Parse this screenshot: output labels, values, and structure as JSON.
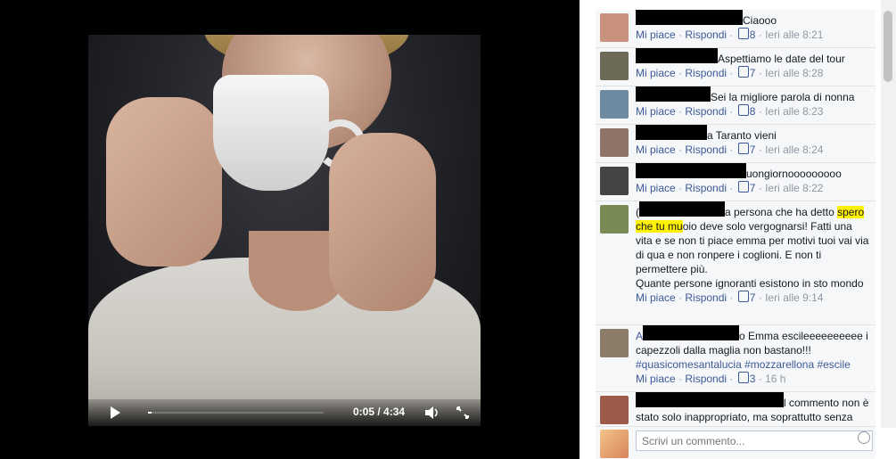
{
  "video": {
    "time": "0:05 / 4:34",
    "progress_fraction": 0.018
  },
  "panel": {
    "close_icon": "×",
    "composer_placeholder": "Scrivi un commento..."
  },
  "labels": {
    "like": "Mi piace",
    "reply": "Rispondi",
    "sep": " · "
  },
  "comments": [
    {
      "text": "Ciaooo",
      "likes": "8",
      "time": "Ieri alle 8:21",
      "avatar_color": "#c9927e"
    },
    {
      "text": "Aspettiamo le date del tour",
      "likes": "7",
      "time": "Ieri alle 8:28",
      "avatar_color": "#6d6a57"
    },
    {
      "text": "Sei la migliore parola di nonna",
      "likes": "8",
      "time": "Ieri alle 8:23",
      "avatar_color": "#6e8aa0"
    },
    {
      "text": "a Taranto vieni",
      "likes": "7",
      "time": "Ieri alle 8:24",
      "avatar_color": "#8d7466"
    },
    {
      "text": "uongiornooooooooo",
      "likes": "7",
      "time": "Ieri alle 8:22",
      "avatar_color": "#444444"
    },
    {
      "prefix": "(",
      "text_before": "a persona che ha detto ",
      "highlight1": "spero",
      "highlight2": "che tu mu",
      "text_after": "oio deve solo vergognarsi! Fatti una vita e se non ti piace emma per motivi tuoi vai via di qua e non ronpere i coglioni. E non ti permettere più.",
      "line2": "Quante persone ignoranti esistono in sto mondo",
      "likes": "7",
      "time": "Ieri alle 9:14",
      "avatar_color": "#7a8a54"
    },
    {
      "prefix": "A",
      "text": "o Emma escileeeeeeeeee i capezzoli dalla maglia non bastano!!!",
      "tags": "#quasicomesantalucia #mozzarellona #escile",
      "likes": "3",
      "time": "16 h",
      "avatar_color": "#8c7c6a"
    },
    {
      "text": "l commento non è stato solo inappropriato, ma soprattutto senza",
      "avatar_color": "#9b5a4a"
    }
  ]
}
